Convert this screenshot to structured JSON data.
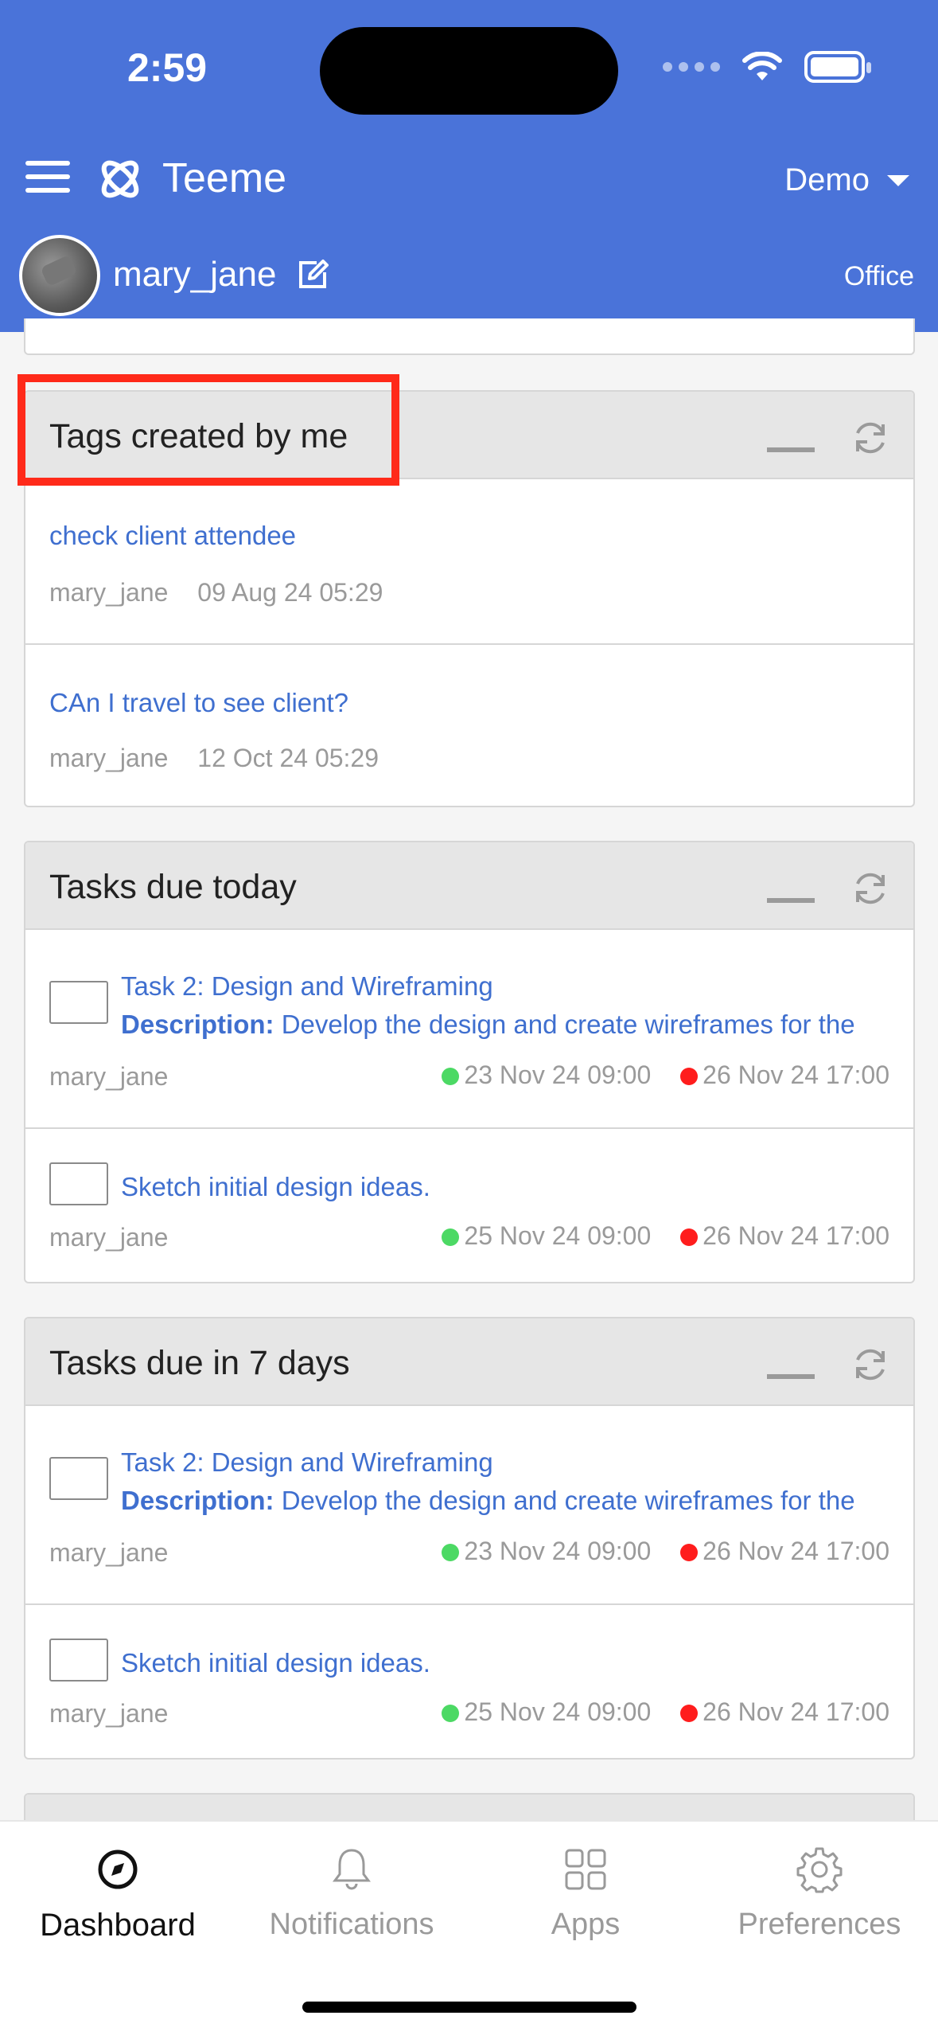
{
  "status_bar": {
    "time": "2:59"
  },
  "header": {
    "app_title": "Teeme",
    "org": "Demo",
    "username": "mary_jane",
    "location": "Office"
  },
  "cards": {
    "tags": {
      "title": "Tags created by me",
      "items": [
        {
          "title": "check client attendee",
          "user": "mary_jane",
          "date": "09 Aug 24 05:29"
        },
        {
          "title": "CAn I travel to see client?",
          "user": "mary_jane",
          "date": "12 Oct 24 05:29"
        }
      ]
    },
    "today": {
      "title": "Tasks due today",
      "items": [
        {
          "title": "Task 2: Design and Wireframing",
          "desc_label": "Description:",
          "desc": " Develop the design and create wireframes for the",
          "user": "mary_jane",
          "start": "23 Nov 24 09:00",
          "end": "26 Nov 24 17:00"
        },
        {
          "title": "Sketch initial design ideas.",
          "user": "mary_jane",
          "start": "25 Nov 24 09:00",
          "end": "26 Nov 24 17:00"
        }
      ]
    },
    "week": {
      "title": "Tasks due in 7 days",
      "items": [
        {
          "title": "Task 2: Design and Wireframing",
          "desc_label": "Description:",
          "desc": " Develop the design and create wireframes for the",
          "user": "mary_jane",
          "start": "23 Nov 24 09:00",
          "end": "26 Nov 24 17:00"
        },
        {
          "title": "Sketch initial design ideas.",
          "user": "mary_jane",
          "start": "25 Nov 24 09:00",
          "end": "26 Nov 24 17:00"
        }
      ]
    }
  },
  "bottom_nav": {
    "dashboard": "Dashboard",
    "notifications": "Notifications",
    "apps": "Apps",
    "preferences": "Preferences"
  },
  "colors": {
    "header": "#4a73d9",
    "link": "#3f6fcf",
    "highlight": "#ff2a1a",
    "start_dot": "#4cd964",
    "end_dot": "#ff1d1d"
  },
  "icons": [
    "menu-icon",
    "teeme-logo-icon",
    "caret-down-icon",
    "edit-icon",
    "refresh-icon",
    "compass-icon",
    "bell-icon",
    "grid-icon",
    "gear-icon"
  ]
}
